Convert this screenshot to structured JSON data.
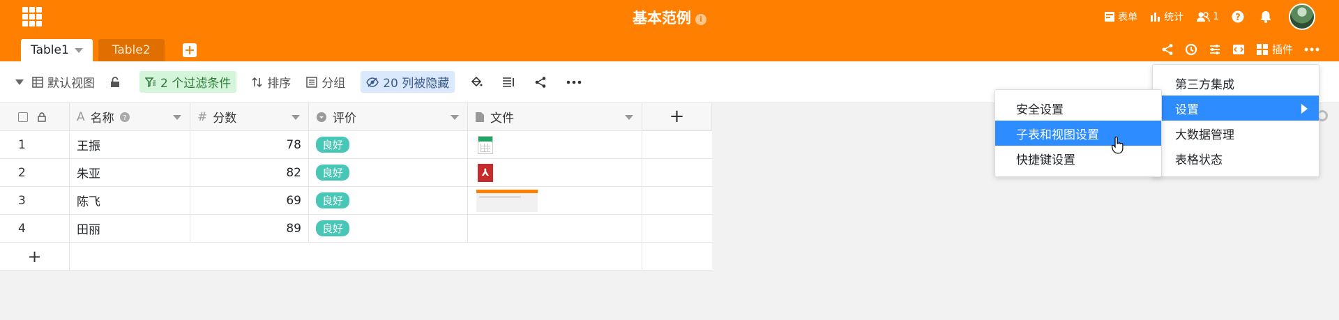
{
  "header": {
    "title": "基本范例",
    "info_badge": "i",
    "form_label": "表单",
    "stats_label": "统计",
    "collaborator_count": "1",
    "help_label": "?",
    "plugins_label": "插件"
  },
  "tabs": [
    {
      "label": "Table1",
      "active": true
    },
    {
      "label": "Table2",
      "active": false
    }
  ],
  "toolbar": {
    "view_name": "默认视图",
    "filter": "2 个过滤条件",
    "sort": "排序",
    "group": "分组",
    "hidden": "20 列被隐藏"
  },
  "columns": [
    {
      "label": "名称",
      "icon": "text-icon"
    },
    {
      "label": "分数",
      "icon": "number-icon"
    },
    {
      "label": "评价",
      "icon": "single-select-icon"
    },
    {
      "label": "文件",
      "icon": "file-icon"
    }
  ],
  "rows": [
    {
      "num": "1",
      "name": "王振",
      "score": "78",
      "rating": "良好",
      "file": "excel"
    },
    {
      "num": "2",
      "name": "朱亚",
      "score": "82",
      "rating": "良好",
      "file": "pdf"
    },
    {
      "num": "3",
      "name": "陈飞",
      "score": "69",
      "rating": "良好",
      "file": "image"
    },
    {
      "num": "4",
      "name": "田丽",
      "score": "89",
      "rating": "良好",
      "file": ""
    }
  ],
  "add_row_label": "+",
  "add_column_label": "+",
  "main_menu": {
    "items": [
      "第三方集成",
      "设置",
      "大数据管理",
      "表格状态"
    ],
    "highlighted": "设置"
  },
  "settings_submenu": {
    "items": [
      "安全设置",
      "子表和视图设置",
      "快捷键设置"
    ],
    "highlighted": "子表和视图设置"
  },
  "colors": {
    "brand": "#ff8000",
    "menu_highlight": "#2d8cff",
    "tag": "#48c6b6"
  }
}
